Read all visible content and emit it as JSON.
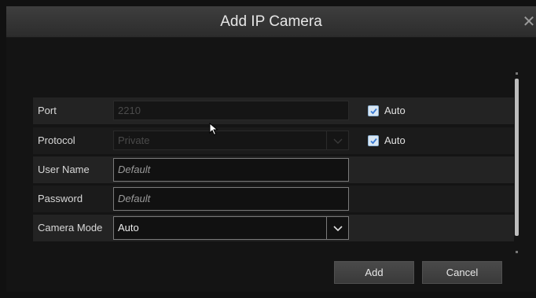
{
  "dialog": {
    "title": "Add IP Camera",
    "close_icon": "close-icon"
  },
  "form": {
    "port": {
      "label": "Port",
      "value": "2210",
      "auto_label": "Auto",
      "auto_checked": true
    },
    "protocol": {
      "label": "Protocol",
      "value": "Private",
      "auto_label": "Auto",
      "auto_checked": true
    },
    "user_name": {
      "label": "User Name",
      "placeholder": "Default"
    },
    "password": {
      "label": "Password",
      "placeholder": "Default"
    },
    "camera_mode": {
      "label": "Camera Mode",
      "value": "Auto"
    }
  },
  "buttons": {
    "add_label": "Add",
    "cancel_label": "Cancel"
  },
  "colors": {
    "checkbox_fill": "#d8e6f2",
    "checkmark": "#3a7bd5"
  }
}
